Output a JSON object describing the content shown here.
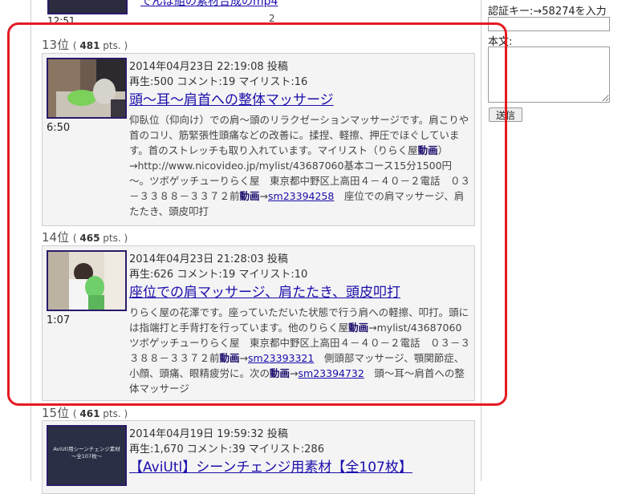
{
  "top_item": {
    "duration": "12:51",
    "title_fragment": "でんぱ組の素材合成のmp4",
    "counter": "2"
  },
  "items": [
    {
      "rank": "13",
      "rank_suffix": "位",
      "points": "481",
      "points_unit": "pts.",
      "posted": "2014年04月23日 22:19:08 投稿",
      "stats": "再生:500 コメント:19 マイリスト:16",
      "title": "頭～耳～肩首への整体マッサージ",
      "duration": "6:50",
      "desc": {
        "t1": "仰臥位（仰向け）での肩～頭のリラクゼーションマッサージです。肩こりや首のコリ、筋緊張性頭痛などの改善に。揉捏、軽擦、押圧でほぐしています。首のストレッチも取り入れています。マイリスト（りらく屋",
        "l1": "動画",
        "t2": "）→http://www.nicovideo.jp/mylist/43687060基本コース15分1500円～。ツボゲッチューりらく屋　東京都中野区上高田４－４０－２電話　０３－３３８８－３３７２前",
        "l2": "動画",
        "t3": "→",
        "l3": "sm23394258",
        "t4": "　座位での肩マッサージ、肩たたき、頭皮叩打"
      }
    },
    {
      "rank": "14",
      "rank_suffix": "位",
      "points": "465",
      "points_unit": "pts.",
      "posted": "2014年04月23日 21:28:03 投稿",
      "stats": "再生:626 コメント:19 マイリスト:10",
      "title": "座位での肩マッサージ、肩たたき、頭皮叩打",
      "duration": "1:07",
      "desc": {
        "t1": "りらく屋の花澤です。座っていただいた状態で行う肩への軽擦、叩打。頭には指端打と手背打を行っています。他のりらく屋",
        "l1": "動画",
        "t2": "→mylist/43687060ツボゲッチューりらく屋　東京都中野区上高田４－４０－２電話　０３－３３８８－３３７２前",
        "l2": "動画",
        "t3": "→",
        "l3": "sm23393321",
        "t4": "　側頭部マッサージ、顎関節症、小顔、頭痛、眼精疲労に。次の",
        "l4": "動画",
        "t5": "→",
        "l5": "sm23394732",
        "t6": "　頭～耳～肩首への整体マッサージ"
      }
    },
    {
      "rank": "15",
      "rank_suffix": "位",
      "points": "461",
      "points_unit": "pts.",
      "posted": "2014年04月19日 19:59:32 投稿",
      "stats": "再生:1,670 コメント:39 マイリスト:286",
      "title": "【AviUtl】シーンチェンジ用素材【全107枚】",
      "thumb_text_1": "AviUtl用シーンチェンジ素材",
      "thumb_text_2": "～全107枚～"
    }
  ],
  "sidebar": {
    "auth_label": "認証キー:→58274を入力",
    "auth_value": "",
    "body_label": "本文:",
    "body_value": "",
    "submit_label": "送信"
  },
  "colors": {
    "link": "#1a0dab",
    "highlight": "#e31b23",
    "card_bg": "#f4f4f4",
    "thumb_border": "#2a1a6a"
  }
}
